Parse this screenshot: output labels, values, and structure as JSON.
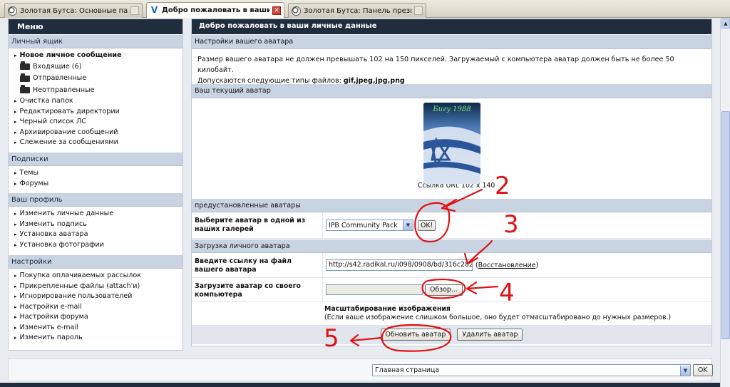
{
  "tabs": [
    {
      "label": "Золотая Бутса: Основные параметры",
      "icon": "soccer-ball-icon",
      "active": false
    },
    {
      "label": "Добро пожаловать в ваши личн...",
      "icon": "forum-logo-icon",
      "active": true
    },
    {
      "label": "Золотая Бутса: Панель президента ...",
      "icon": "soccer-ball-icon",
      "active": false
    }
  ],
  "sidebar": {
    "title": "Меню",
    "sections": [
      {
        "title": "Личный ящик",
        "new_message": "Новое личное сообщение",
        "folders": [
          "Входящие (6)",
          "Отправленные",
          "Неотправленные"
        ],
        "items": [
          "Очистка папок",
          "Редактировать директории",
          "Черный список ЛС",
          "Архивирование сообщений",
          "Слежение за сообщениями"
        ]
      },
      {
        "title": "Подписки",
        "items": [
          "Темы",
          "Форумы"
        ]
      },
      {
        "title": "Ваш профиль",
        "items": [
          "Изменить личные данные",
          "Изменить подпись",
          "Установка аватара",
          "Установка фотографии"
        ]
      },
      {
        "title": "Настройки",
        "items": [
          "Покупка оплачиваемых рассылок",
          "Прикрепленные файлы (attach'и)",
          "Игнорирование пользователей",
          "Настройки e-mail",
          "Настройки форума",
          "Изменить e-mail",
          "Изменить пароль"
        ]
      }
    ]
  },
  "main": {
    "title": "Добро пожаловать в ваши личные данные",
    "settings_header": "Настройки вашего аватара",
    "info_line1": "Размер вашего аватара не должен превышать 102 на 150 пикселей. Загружаемый с компьютера аватар должен быть не более 50 килобайт.",
    "info_line2_prefix": "Допускаются следующие типы файлов: ",
    "info_line2_types": "gif,jpeg,jpg,png",
    "current_avatar_header": "Ваш текущий аватар",
    "avatar_text": "Бигу 1988",
    "avatar_caption": "Ссылка URL 102 x 140",
    "preset_header": "предустановленные аватары",
    "gallery_label": "Выберите аватар в одной из наших галерей",
    "gallery_value": "IPB Community Pack",
    "ok_label": "OK!",
    "upload_header": "Загрузка личного аватара",
    "url_label": "Введите ссылку на файл вашего аватара",
    "url_value": "http://s42.radikal.ru/i098/0908/bd/316c282",
    "restore_link": "Восстановление",
    "upload_label": "Загрузите аватар со своего компьютера",
    "browse_label": "Обзор...",
    "scale_title": "Масштабирование изображения",
    "scale_note": "(Если ваше изображение слишком большое, оно будет отмасштабировано до нужных размеров.)",
    "update_button": "Обновить аватар",
    "delete_button": "Удалить аватар"
  },
  "bottom": {
    "jump_value": "Главная страница",
    "ok_label": "OK"
  },
  "annotations": [
    "2",
    "3",
    "4",
    "5"
  ],
  "colors": {
    "header_dark": "#1f2d3d",
    "section_blue": "#c9d4e3",
    "annotation_red": "#e01212"
  }
}
